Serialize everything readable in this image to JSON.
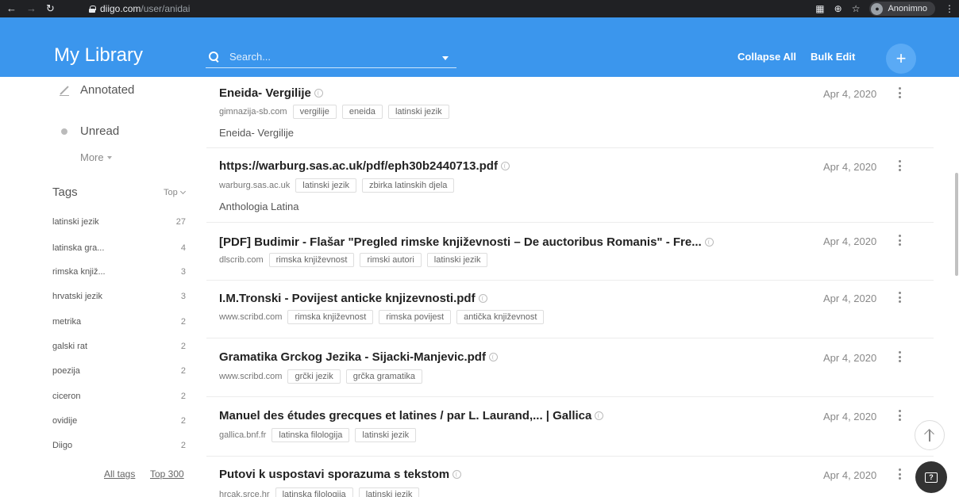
{
  "browser": {
    "url_host": "diigo.com",
    "url_path": "/user/anidai",
    "profile_name": "Anonimno"
  },
  "header": {
    "title": "My Library",
    "search_placeholder": "Search...",
    "collapse_all": "Collapse All",
    "bulk_edit": "Bulk Edit",
    "add_label": "+"
  },
  "sidebar": {
    "annotated": "Annotated",
    "unread": "Unread",
    "more": "More",
    "tags_heading": "Tags",
    "tags_sort": "Top",
    "tags": [
      {
        "name": "latinski jezik",
        "count": "27"
      },
      {
        "name": "latinska gra...",
        "count": "4"
      },
      {
        "name": "rimska knjiž...",
        "count": "3"
      },
      {
        "name": "hrvatski jezik",
        "count": "3"
      },
      {
        "name": "metrika",
        "count": "2"
      },
      {
        "name": "galski rat",
        "count": "2"
      },
      {
        "name": "poezija",
        "count": "2"
      },
      {
        "name": "ciceron",
        "count": "2"
      },
      {
        "name": "ovidije",
        "count": "2"
      },
      {
        "name": "Diigo",
        "count": "2"
      }
    ],
    "all_tags": "All tags",
    "top_300": "Top 300"
  },
  "bookmarks": [
    {
      "title": "Eneida- Vergilije",
      "domain": "gimnazija-sb.com",
      "tags": [
        "vergilije",
        "eneida",
        "latinski jezik"
      ],
      "description": "Eneida- Vergilije",
      "date": "Apr 4, 2020"
    },
    {
      "title": "https://warburg.sas.ac.uk/pdf/eph30b2440713.pdf",
      "domain": "warburg.sas.ac.uk",
      "tags": [
        "latinski jezik",
        "zbirka latinskih djela"
      ],
      "description": "Anthologia Latina",
      "date": "Apr 4, 2020"
    },
    {
      "title": "[PDF] Budimir - Flašar \"Pregled rimske književnosti – De auctoribus Romanis\" - Fre...",
      "domain": "dlscrib.com",
      "tags": [
        "rimska književnost",
        "rimski autori",
        "latinski jezik"
      ],
      "description": "",
      "date": "Apr 4, 2020"
    },
    {
      "title": "I.M.Tronski - Povijest anticke knjizevnosti.pdf",
      "domain": "www.scribd.com",
      "tags": [
        "rimska književnost",
        "rimska povijest",
        "antička književnost"
      ],
      "description": "",
      "date": "Apr 4, 2020"
    },
    {
      "title": "Gramatika Grckog Jezika - Sijacki-Manjevic.pdf",
      "domain": "www.scribd.com",
      "tags": [
        "grčki jezik",
        "grčka gramatika"
      ],
      "description": "",
      "date": "Apr 4, 2020"
    },
    {
      "title": "Manuel des études grecques et latines / par L. Laurand,... | Gallica",
      "domain": "gallica.bnf.fr",
      "tags": [
        "latinska filologija",
        "latinski jezik"
      ],
      "description": "",
      "date": "Apr 4, 2020"
    },
    {
      "title": "Putovi k uspostavi sporazuma s tekstom",
      "domain": "hrcak.srce.hr",
      "tags": [
        "latinska filologija",
        "latinski jezik"
      ],
      "description": "",
      "date": "Apr 4, 2020"
    }
  ],
  "colors": {
    "header_blue": "#3b96ed",
    "chrome_dark": "#202124"
  }
}
